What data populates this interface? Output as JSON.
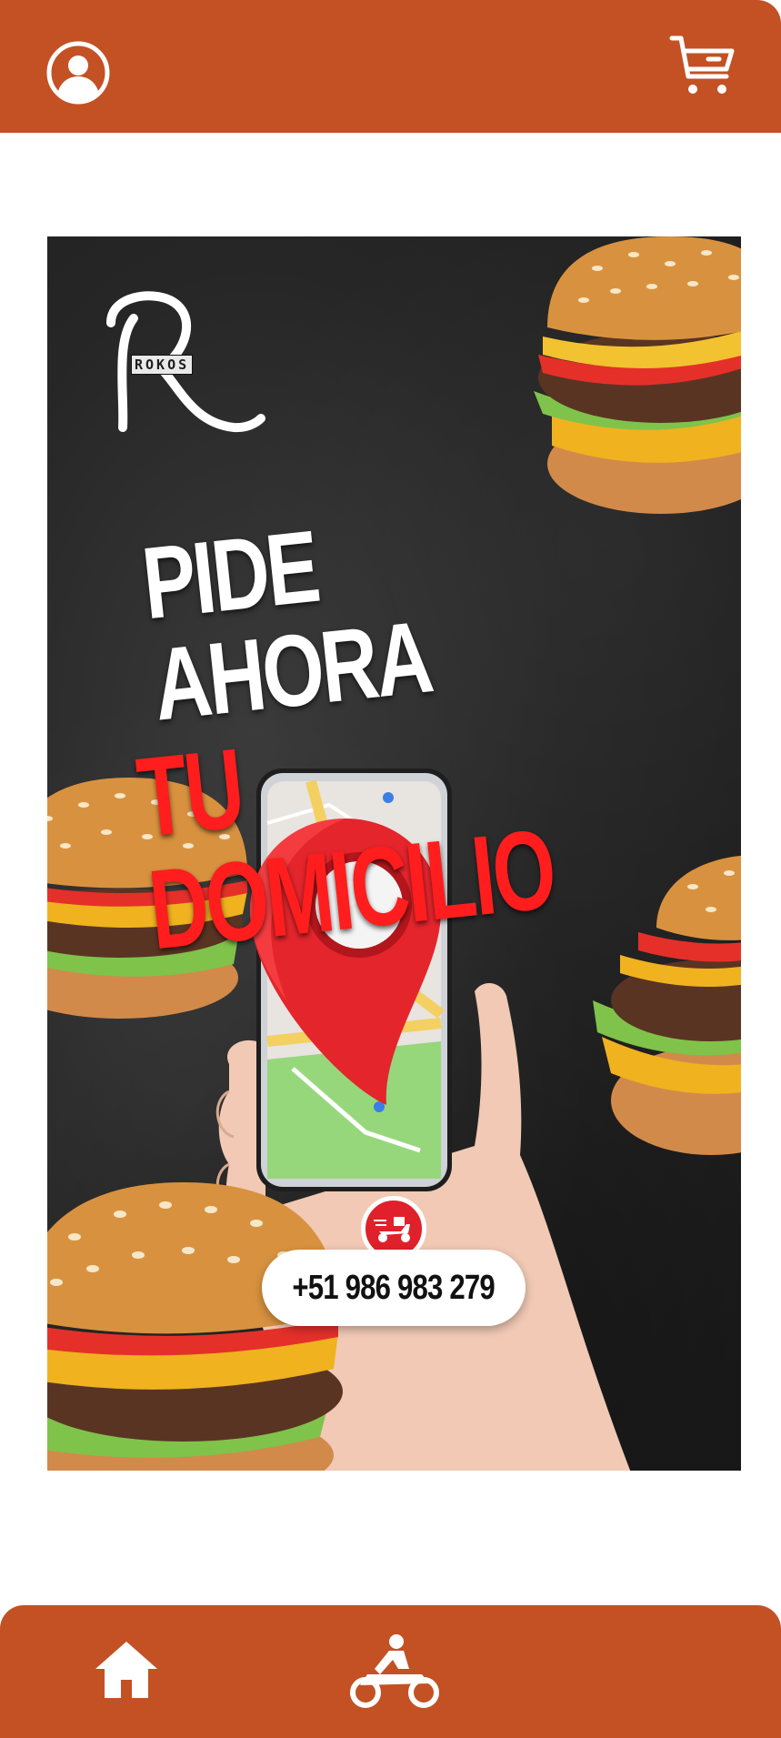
{
  "header": {
    "profile_icon": "user-circle-icon",
    "cart_icon": "cart-icon"
  },
  "banner": {
    "brand": "ROKOS",
    "headline_line1": "PIDE AHORA",
    "headline_line2": "TU DOMICILIO",
    "phone": "+51 986 983 279",
    "accent_color": "#ff1d1d"
  },
  "bottom_nav": {
    "items": [
      {
        "icon": "home-icon"
      },
      {
        "icon": "delivery-motorbike-icon"
      }
    ]
  },
  "colors": {
    "bar": "#c35124",
    "background": "#ffffff"
  }
}
